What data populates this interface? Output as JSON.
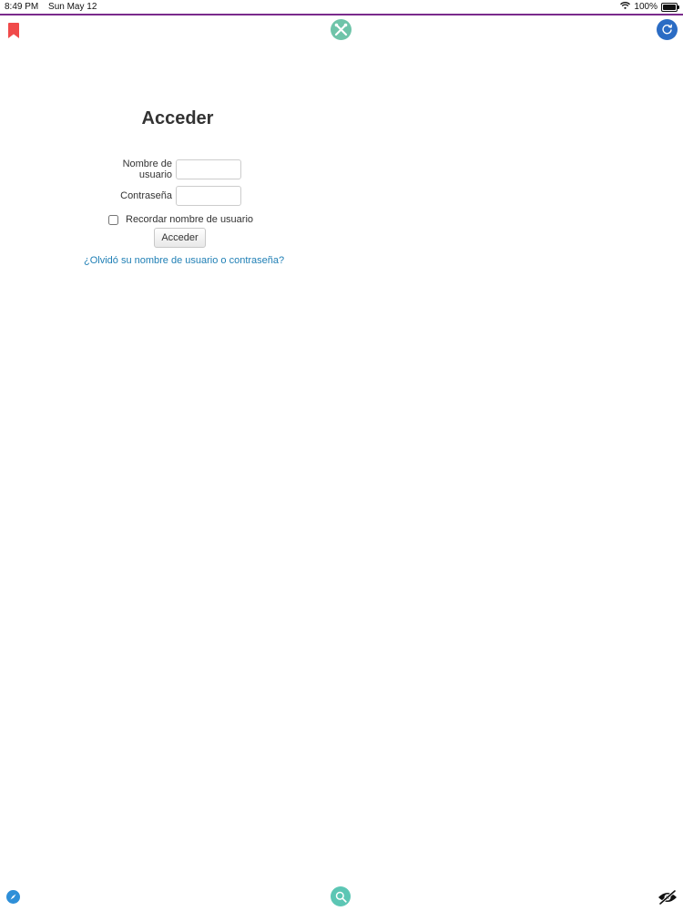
{
  "status_bar": {
    "time": "8:49 PM",
    "date": "Sun May 12",
    "battery_percent": "100%",
    "wifi_icon": "wifi-icon",
    "battery_icon": "battery-icon"
  },
  "toolbar": {
    "left_icon": "bookmark-icon",
    "center_icon": "tools-icon",
    "right_icon": "refresh-icon"
  },
  "login": {
    "title": "Acceder",
    "username_label": "Nombre de usuario",
    "username_value": "",
    "password_label": "Contraseña",
    "password_value": "",
    "remember_label": "Recordar nombre de usuario",
    "remember_checked": false,
    "submit_label": "Acceder",
    "forgot_link": "¿Olvidó su nombre de usuario o contraseña?"
  },
  "bottom_bar": {
    "left_icon": "compass-icon",
    "center_icon": "search-icon",
    "right_icon": "eye-slash-icon"
  },
  "colors": {
    "status_border": "#7a2a8c",
    "bookmark": "#f04a4a",
    "tools_bg": "#6fc4a9",
    "refresh_bg": "#2b6cc4",
    "compass_bg": "#2e8fd8",
    "search_bg": "#5cc6b4",
    "link": "#1f7fb5"
  }
}
